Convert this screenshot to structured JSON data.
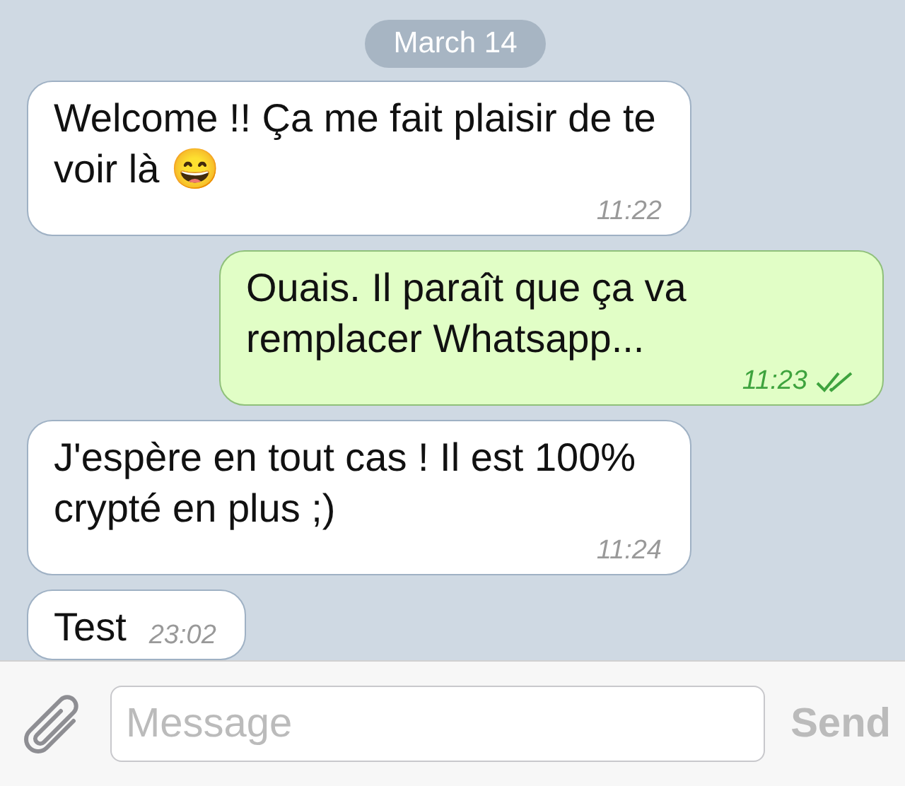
{
  "date_badge": "March 14",
  "messages": [
    {
      "kind": "incoming",
      "text": "Welcome !! Ça me fait plaisir de te voir là 😄",
      "time": "11:22"
    },
    {
      "kind": "outgoing",
      "text": "Ouais. Il paraît que ça va remplacer Whatsapp...",
      "time": "11:23",
      "read": true
    },
    {
      "kind": "incoming",
      "text": "J'espère en tout cas ! Il est 100% crypté en plus ;)",
      "time": "11:24"
    },
    {
      "kind": "incoming",
      "text": "Test",
      "time": "23:02"
    }
  ],
  "composer": {
    "placeholder": "Message",
    "send_label": "Send"
  }
}
